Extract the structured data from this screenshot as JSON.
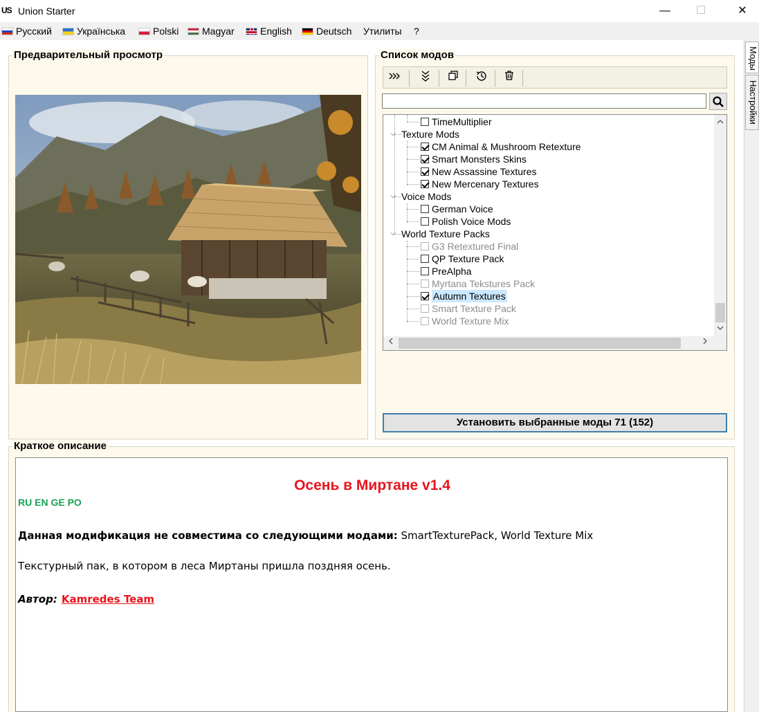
{
  "window": {
    "logo": "US",
    "title": "Union Starter",
    "minimize": "—",
    "maximize": "☐",
    "close": "✕"
  },
  "menu": {
    "items": [
      {
        "label": "Русский",
        "flag": "ru"
      },
      {
        "label": "Українська",
        "flag": "ua"
      },
      {
        "label": "Polski",
        "flag": "pl"
      },
      {
        "label": "Magyar",
        "flag": "hu"
      },
      {
        "label": "English",
        "flag": "gb"
      },
      {
        "label": "Deutsch",
        "flag": "de"
      },
      {
        "label": "Утилиты"
      },
      {
        "label": "?"
      }
    ]
  },
  "preview": {
    "title": "Предварительный просмотр"
  },
  "modlist": {
    "title": "Список модов",
    "toolbar_icons": [
      "expand-all-icon",
      "collapse-all-icon",
      "copy-icon",
      "history-icon",
      "trash-icon"
    ],
    "search_placeholder": "",
    "tree": [
      {
        "label": "TimeMultiplier",
        "checked": false,
        "disabled": false
      },
      {
        "label": "Texture Mods",
        "group": true
      },
      {
        "label": "CM Animal & Mushroom Retexture",
        "checked": true,
        "disabled": false
      },
      {
        "label": "Smart Monsters Skins",
        "checked": true,
        "disabled": false
      },
      {
        "label": "New Assassine Textures",
        "checked": true,
        "disabled": false
      },
      {
        "label": "New Mercenary Textures",
        "checked": true,
        "disabled": false
      },
      {
        "label": "Voice Mods",
        "group": true
      },
      {
        "label": "German Voice",
        "checked": false,
        "disabled": false
      },
      {
        "label": "Polish Voice Mods",
        "checked": false,
        "disabled": false
      },
      {
        "label": "World Texture Packs",
        "group": true
      },
      {
        "label": "G3 Retextured Final",
        "checked": false,
        "disabled": true
      },
      {
        "label": "QP Texture Pack",
        "checked": false,
        "disabled": false
      },
      {
        "label": "PreAlpha",
        "checked": false,
        "disabled": false
      },
      {
        "label": "Myrtana Tekstures Pack",
        "checked": false,
        "disabled": true
      },
      {
        "label": "Autumn Textures",
        "checked": true,
        "disabled": false,
        "selected": true
      },
      {
        "label": "Smart Texture Pack",
        "checked": false,
        "disabled": true
      },
      {
        "label": "World Texture Mix",
        "checked": false,
        "disabled": true
      }
    ],
    "install_button": "Установить выбранные моды 71 (152)"
  },
  "description": {
    "section_title": "Краткое описание",
    "title": "Осень в Миртане v1.4",
    "languages": "RU EN GE PO",
    "incompat_label": "Данная модификация не совместима со следующими модами:",
    "incompat_mods": " SmartTexturePack, World Texture Mix",
    "text": "Текстурный пак, в котором в леса Миртаны пришла поздняя осень.",
    "author_label": "Автор:",
    "author_name": "Kamredes Team"
  },
  "side_tabs": [
    "Моды",
    "Настройки"
  ],
  "colors": {
    "panel_bg": "#fdf9ec",
    "accent_red": "#e8141c",
    "lang_green": "#1aa155",
    "selection": "#cce8ff"
  }
}
